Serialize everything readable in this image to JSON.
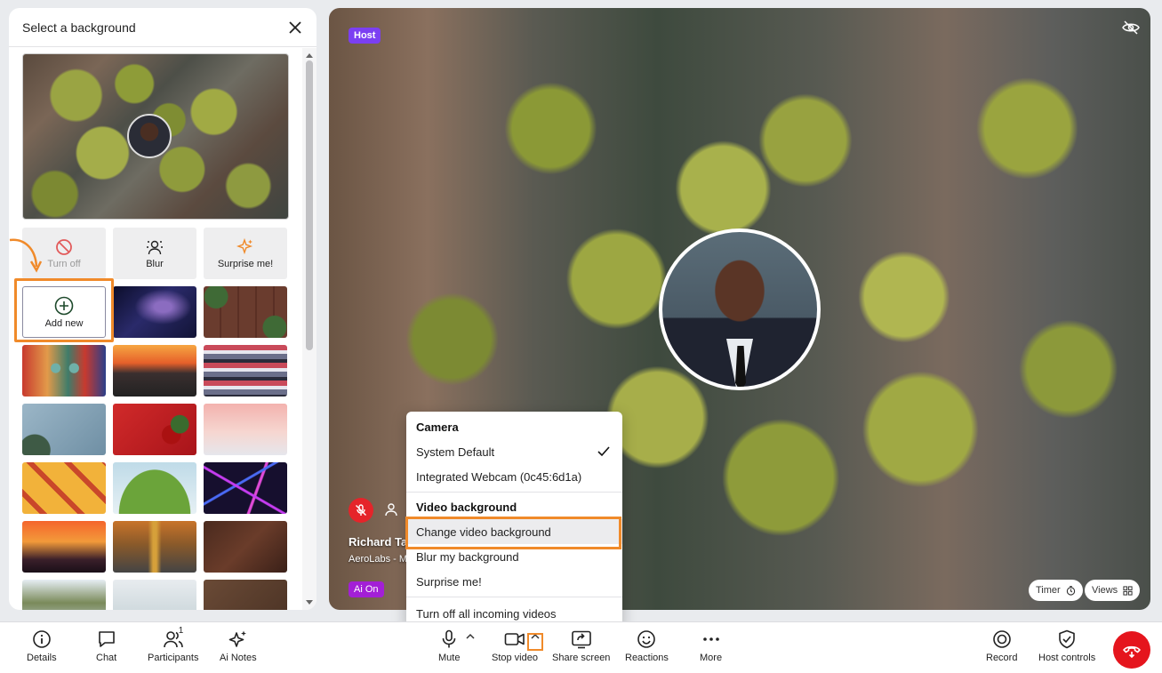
{
  "panel": {
    "title": "Select a background",
    "options": [
      {
        "label": "Turn off",
        "icon": "ban-icon"
      },
      {
        "label": "Blur",
        "icon": "blur-person-icon"
      },
      {
        "label": "Surprise me!",
        "icon": "sparkle-icon"
      }
    ],
    "add_new_label": "Add new",
    "thumbnails": [
      "galaxy",
      "wooden-planks",
      "graffiti-face",
      "sunset-sea",
      "graffiti-wall",
      "frosted-blue",
      "red-berries",
      "pink-snow",
      "hot-dogs",
      "green-hill",
      "neon-lines",
      "palm-sunset",
      "autumn-road",
      "dark-wood",
      "lake-trees",
      "snow-trees",
      "brown-panel"
    ]
  },
  "video": {
    "host_badge": "Host",
    "participant_name": "Richard Tay",
    "participant_company": "AeroLabs - M",
    "ai_badge": "Ai On",
    "timer_label": "Timer",
    "views_label": "Views"
  },
  "menu": {
    "camera_title": "Camera",
    "camera_items": [
      {
        "label": "System Default",
        "checked": true
      },
      {
        "label": "Integrated Webcam (0c45:6d1a)",
        "checked": false
      }
    ],
    "vb_title": "Video background",
    "vb_items": [
      "Change video background",
      "Blur my background",
      "Surprise me!"
    ],
    "turn_off_incoming": "Turn off all incoming videos"
  },
  "toolbar": {
    "details": "Details",
    "chat": "Chat",
    "participants": "Participants",
    "participants_count": "1",
    "ai_notes": "Ai Notes",
    "mute": "Mute",
    "stop_video": "Stop video",
    "share_screen": "Share screen",
    "reactions": "Reactions",
    "more": "More",
    "record": "Record",
    "host_controls": "Host controls"
  },
  "colors": {
    "accent_orange": "#f08a2a",
    "host_purple": "#7b3ff2",
    "ai_purple": "#a31fd6",
    "end_red": "#e5151d"
  }
}
